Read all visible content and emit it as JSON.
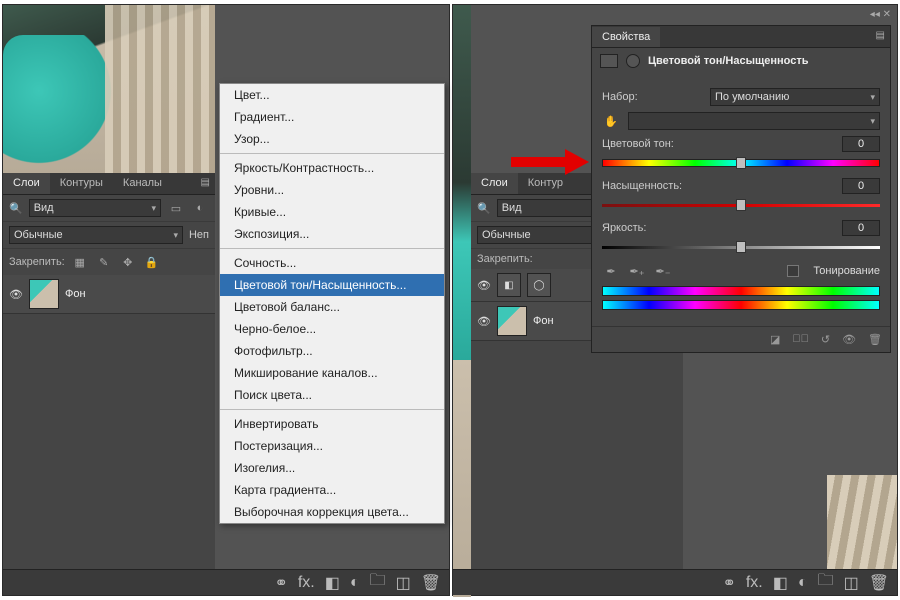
{
  "left": {
    "tabs": [
      "Слои",
      "Контуры",
      "Каналы"
    ],
    "view_label": "Вид",
    "blend_label": "Обычные",
    "opacity_label": "Неп",
    "lock_label": "Закрепить:",
    "layer_name": "Фон",
    "search_icon": "🔍"
  },
  "ctx": {
    "g1": [
      "Цвет...",
      "Градиент...",
      "Узор..."
    ],
    "g2": [
      "Яркость/Контрастность...",
      "Уровни...",
      "Кривые...",
      "Экспозиция..."
    ],
    "g3": [
      "Сочность...",
      "Цветовой тон/Насыщенность...",
      "Цветовой баланс...",
      "Черно-белое...",
      "Фотофильтр...",
      "Микширование каналов...",
      "Поиск цвета..."
    ],
    "g4": [
      "Инвертировать",
      "Постеризация...",
      "Изогелия...",
      "Карта градиента...",
      "Выборочная коррекция цвета..."
    ],
    "highlight_index": 1
  },
  "right": {
    "top_collapse": "◂◂  ✕",
    "prop_tab": "Свойства",
    "title": "Цветовой тон/Насыщенность",
    "preset_label": "Набор:",
    "preset_value": "По умолчанию",
    "channel_hint": "",
    "hue_label": "Цветовой тон:",
    "hue_value": "0",
    "sat_label": "Насыщенность:",
    "sat_value": "0",
    "light_label": "Яркость:",
    "light_value": "0",
    "colorize_label": "Тонирование",
    "tabs": [
      "Слои",
      "Контур"
    ],
    "view_label": "Вид",
    "blend_label": "Обычные",
    "lock_label": "Закрепить:",
    "layer_fon": "Фон"
  },
  "bottom_icons": {
    "link": "⚭",
    "fx": "fx.",
    "mask": "◧",
    "adjust": "◐",
    "folder": "🗀",
    "new": "◫",
    "trash": "🗑"
  }
}
